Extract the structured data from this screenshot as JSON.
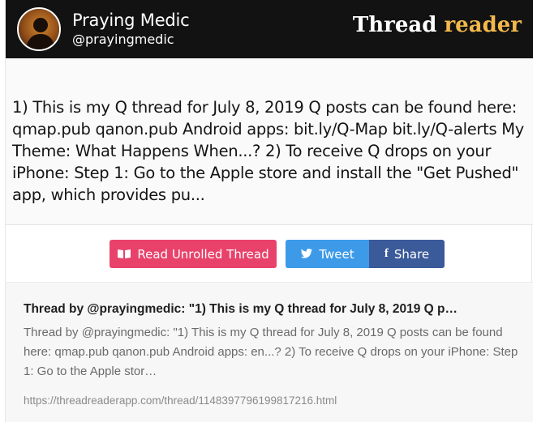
{
  "header": {
    "author_name": "Praying Medic",
    "author_handle": "@prayingmedic",
    "brand_part1": "Thread",
    "brand_part2": "reader",
    "brand_accent": "#f2b84b",
    "avatar_icon": "user-avatar"
  },
  "quote": {
    "text": "1) This is my Q thread for July 8, 2019 Q posts can be found here: qmap.pub qanon.pub Android apps: bit.ly/Q-Map bit.ly/Q-alerts My Theme: What Happens When...? 2) To receive Q drops on your iPhone: Step 1: Go to the Apple store and install the \"Get Pushed\" app, which provides pu..."
  },
  "buttons": {
    "read_label": "Read Unrolled Thread",
    "read_icon": "book-icon",
    "read_color": "#e8426b",
    "tweet_label": "Tweet",
    "tweet_icon": "twitter-bird-icon",
    "tweet_color": "#3d9ae8",
    "share_label": "Share",
    "share_icon": "facebook-icon",
    "share_color": "#3b5a9a"
  },
  "preview": {
    "title": "Thread by @prayingmedic: \"1) This is my Q thread for July 8, 2019 Q p…",
    "description": "Thread by @prayingmedic: \"1) This is my Q thread for July 8, 2019 Q posts can be found here: qmap.pub qanon.pub Android apps: en...? 2) To receive Q drops on your iPhone: Step 1: Go to the Apple stor…",
    "url": "https://threadreaderapp.com/thread/1148397796199817216.html"
  }
}
